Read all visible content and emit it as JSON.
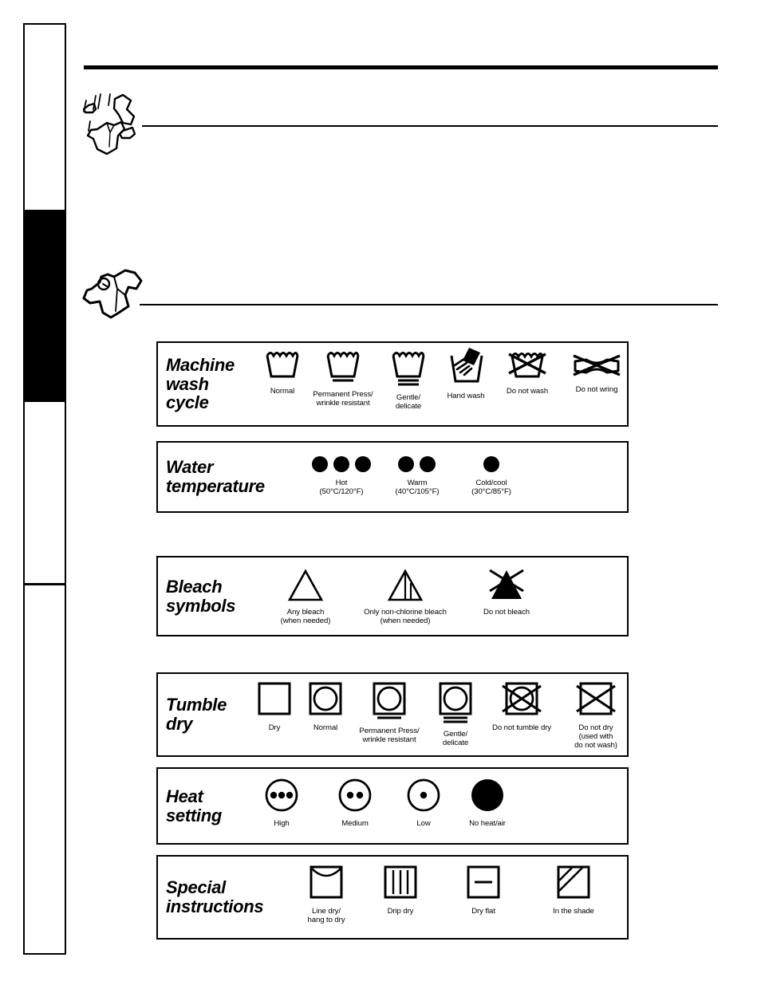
{
  "page": {
    "title": "Laundry care symbols chart",
    "background_color": "#ffffff",
    "ink_color": "#000000"
  },
  "sidebar": {
    "name": "chapter-tab-strip",
    "segments": [
      {
        "label": "",
        "active": false
      },
      {
        "label": "",
        "active": true
      },
      {
        "label": "",
        "active": false
      },
      {
        "label": "",
        "active": false
      }
    ]
  },
  "illustrations": [
    {
      "name": "tumbling-clothes-illustration",
      "caption": ""
    },
    {
      "name": "single-garment-illustration",
      "caption": ""
    }
  ],
  "sections": [
    {
      "id": "machine-wash-cycle",
      "label": "Machine\nwash\ncycle",
      "items": [
        {
          "caption": "Normal",
          "icon": "wash-tub"
        },
        {
          "caption": "Permanent Press/\nwrinkle resistant",
          "icon": "wash-tub-one-bar"
        },
        {
          "caption": "Gentle/\ndelicate",
          "icon": "wash-tub-two-bars"
        },
        {
          "caption": "Hand wash",
          "icon": "hand-wash-tub"
        },
        {
          "caption": "Do not wash",
          "icon": "wash-tub-crossed"
        },
        {
          "caption": "Do not wring",
          "icon": "wring-crossed"
        }
      ]
    },
    {
      "id": "water-temperature",
      "label": "Water\ntemperature",
      "items": [
        {
          "caption": "Hot\n(50°C/120°F)",
          "icon": "three-dots"
        },
        {
          "caption": "Warm\n(40°C/105°F)",
          "icon": "two-dots"
        },
        {
          "caption": "Cold/cool\n(30°C/85°F)",
          "icon": "one-dot"
        }
      ]
    },
    {
      "id": "bleach-symbols",
      "label": "Bleach\nsymbols",
      "items": [
        {
          "caption": "Any bleach\n(when needed)",
          "icon": "triangle-open"
        },
        {
          "caption": "Only non-chlorine bleach\n(when needed)",
          "icon": "triangle-striped"
        },
        {
          "caption": "Do not bleach",
          "icon": "triangle-filled-crossed"
        }
      ]
    },
    {
      "id": "tumble-dry",
      "label": "Tumble\ndry",
      "items": [
        {
          "caption": "Dry",
          "icon": "square"
        },
        {
          "caption": "Normal",
          "icon": "square-circle"
        },
        {
          "caption": "Permanent Press/\nwrinkle resistant",
          "icon": "square-circle-one-bar"
        },
        {
          "caption": "Gentle/\ndelicate",
          "icon": "square-circle-two-bars"
        },
        {
          "caption": "Do not tumble dry",
          "icon": "square-circle-crossed"
        },
        {
          "caption": "Do not dry\n(used with\ndo not wash)",
          "icon": "square-crossed"
        }
      ]
    },
    {
      "id": "heat-setting",
      "label": "Heat\nsetting",
      "items": [
        {
          "caption": "High",
          "icon": "circle-three-dots"
        },
        {
          "caption": "Medium",
          "icon": "circle-two-dots"
        },
        {
          "caption": "Low",
          "icon": "circle-one-dot"
        },
        {
          "caption": "No heat/air",
          "icon": "circle-filled"
        }
      ]
    },
    {
      "id": "special-instructions",
      "label": "Special\ninstructions",
      "items": [
        {
          "caption": "Line dry/\nhang to dry",
          "icon": "line-dry"
        },
        {
          "caption": "Drip dry",
          "icon": "drip-dry"
        },
        {
          "caption": "Dry flat",
          "icon": "dry-flat"
        },
        {
          "caption": "In the shade",
          "icon": "in-the-shade"
        }
      ]
    }
  ]
}
